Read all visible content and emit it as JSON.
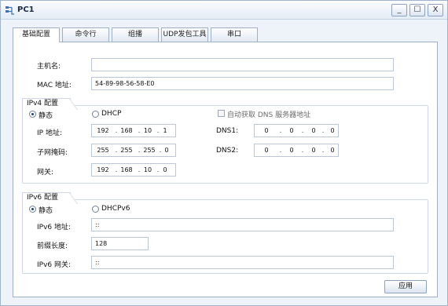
{
  "window": {
    "title": "PC1",
    "minimize": "_",
    "maximize": "☐",
    "close": "X"
  },
  "tabs": [
    {
      "label": "基础配置",
      "active": true
    },
    {
      "label": "命令行"
    },
    {
      "label": "组播"
    },
    {
      "label": "UDP发包工具"
    },
    {
      "label": "串口"
    }
  ],
  "basic": {
    "hostname_label": "主机名:",
    "hostname_value": "",
    "mac_label": "MAC 地址:",
    "mac_value": "54-89-98-56-58-E0"
  },
  "ipv4": {
    "group_title": "IPv4 配置",
    "static_label": "静态",
    "dhcp_label": "DHCP",
    "mode": "static",
    "auto_dns_label": "自动获取 DNS 服务器地址",
    "ip_label": "IP 地址:",
    "ip": [
      "192",
      "168",
      "10",
      "1"
    ],
    "mask_label": "子网掩码:",
    "mask": [
      "255",
      "255",
      "255",
      "0"
    ],
    "gateway_label": "网关:",
    "gateway": [
      "192",
      "168",
      "10",
      "0"
    ],
    "dns1_label": "DNS1:",
    "dns1": [
      "0",
      "0",
      "0",
      "0"
    ],
    "dns2_label": "DNS2:",
    "dns2": [
      "0",
      "0",
      "0",
      "0"
    ]
  },
  "ipv6": {
    "group_title": "IPv6 配置",
    "static_label": "静态",
    "dhcpv6_label": "DHCPv6",
    "mode": "static",
    "addr_label": "IPv6 地址:",
    "addr_value": "::",
    "prefix_label": "前缀长度:",
    "prefix_value": "128",
    "gw_label": "IPv6 网关:",
    "gw_value": "::"
  },
  "apply_label": "应用"
}
